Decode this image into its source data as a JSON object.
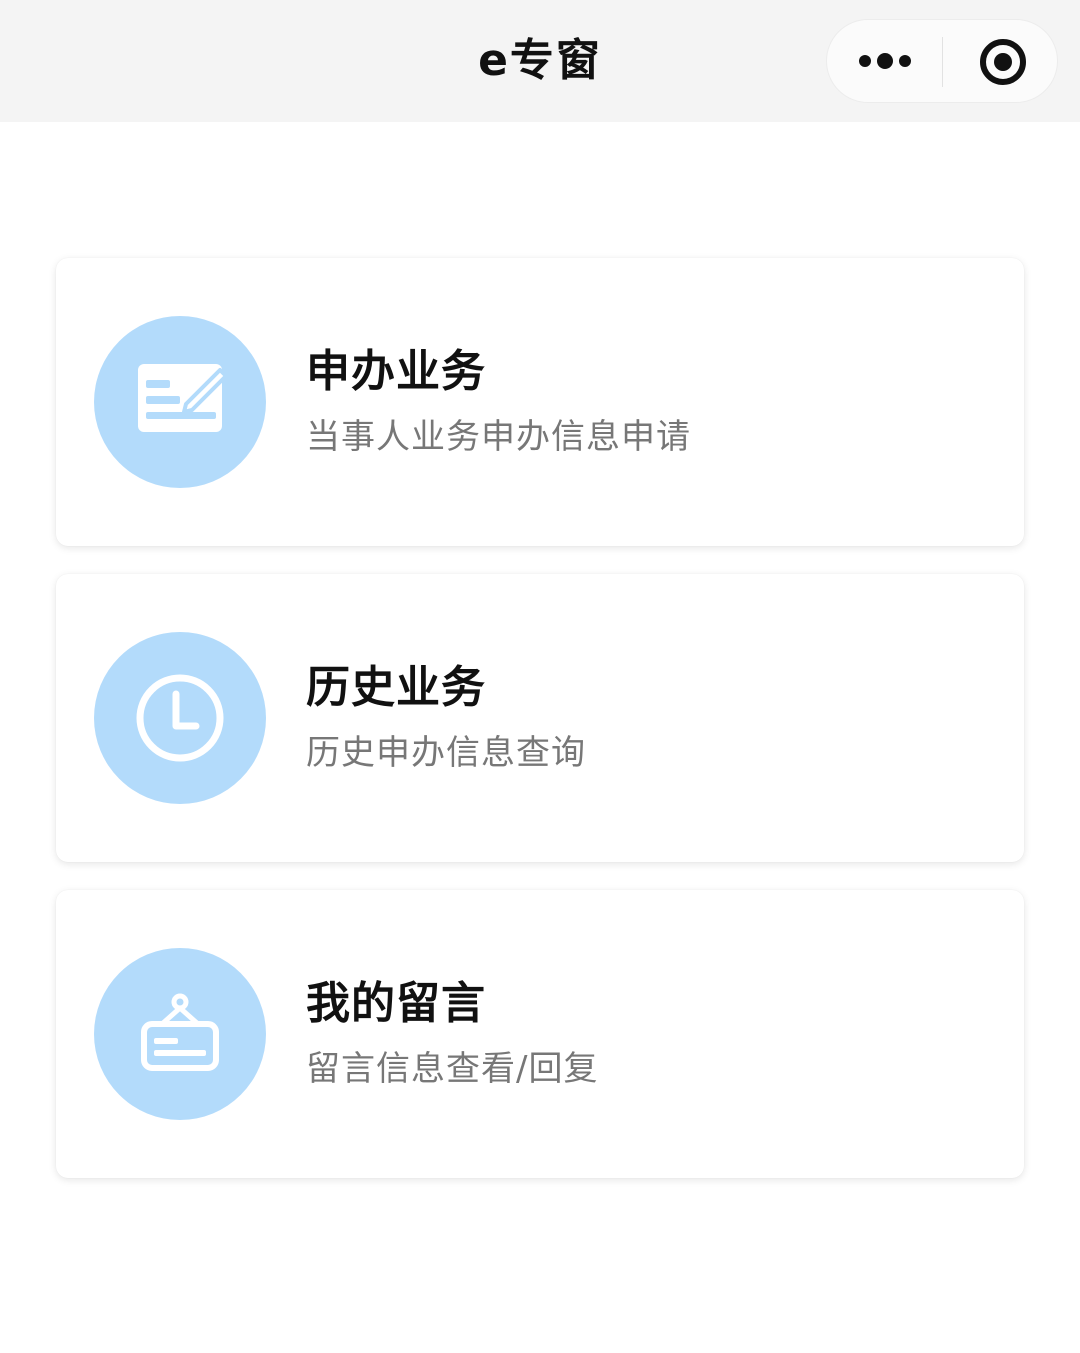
{
  "header": {
    "title": "e专窗",
    "more_icon": "more-dots-icon",
    "close_icon": "target-close-icon"
  },
  "colors": {
    "icon_circle": "#b3dbfb",
    "title_text": "#111111",
    "subtitle_text": "#777777",
    "topbar_bg": "#f4f4f4"
  },
  "cards": [
    {
      "title": "申办业务",
      "subtitle": "当事人业务申办信息申请",
      "icon": "form-edit-icon"
    },
    {
      "title": "历史业务",
      "subtitle": "历史申办信息查询",
      "icon": "clock-icon"
    },
    {
      "title": "我的留言",
      "subtitle": "留言信息查看/回复",
      "icon": "hanging-sign-icon"
    }
  ]
}
